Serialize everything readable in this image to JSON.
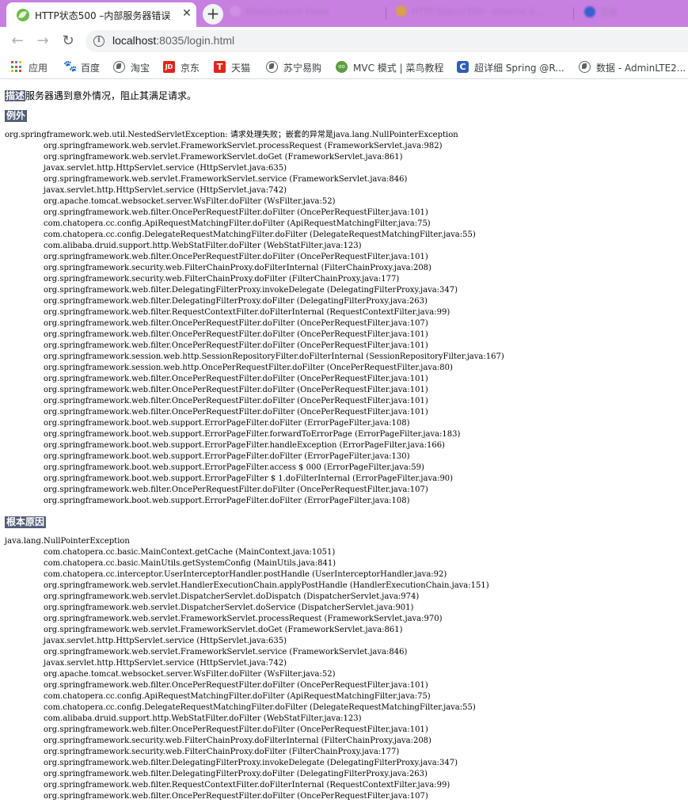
{
  "browser": {
    "active_tab": {
      "title": "HTTP状态500 –内部服务器错误"
    },
    "other_tabs": [
      "Elasticsearch Head",
      "HTTP Status 500 - Internal S...",
      "百度"
    ],
    "url": {
      "host": "localhost",
      "rest": ":8035/login.html"
    }
  },
  "bookmarks": [
    {
      "label": "应用",
      "icon": "apps-grid-icon"
    },
    {
      "label": "百度",
      "icon": "baidu-paw-icon"
    },
    {
      "label": "淘宝",
      "icon": "globe-icon"
    },
    {
      "label": "京东",
      "icon": "jd-icon"
    },
    {
      "label": "天猫",
      "icon": "tmall-icon"
    },
    {
      "label": "苏宁易购",
      "icon": "globe-icon"
    },
    {
      "label": "MVC 模式 | 菜鸟教程",
      "icon": "runoob-icon"
    },
    {
      "label": "超详细 Spring @R...",
      "icon": "c-icon"
    },
    {
      "label": "数据 - AdminLTE2...",
      "icon": "globe-icon"
    }
  ],
  "error_page": {
    "description_label": "描述",
    "description_text": "服务器遇到意外情况，阻止其满足请求。",
    "exception_label": "例外",
    "exception_head": "org.springframework.web.util.NestedServletException: 请求处理失败；嵌套的异常是java.lang.NullPointerException",
    "exception_frames": [
      "org.springframework.web.servlet.FrameworkServlet.processRequest (FrameworkServlet.java:982)",
      "org.springframework.web.servlet.FrameworkServlet.doGet (FrameworkServlet.java:861)",
      "javax.servlet.http.HttpServlet.service (HttpServlet.java:635)",
      "org.springframework.web.servlet.FrameworkServlet.service (FrameworkServlet.java:846)",
      "javax.servlet.http.HttpServlet.service (HttpServlet.java:742)",
      "org.apache.tomcat.websocket.server.WsFilter.doFilter (WsFilter.java:52)",
      "org.springframework.web.filter.OncePerRequestFilter.doFilter (OncePerRequestFilter.java:101)",
      "com.chatopera.cc.config.ApiRequestMatchingFilter.doFilter (ApiRequestMatchingFilter.java:75)",
      "com.chatopera.cc.config.DelegateRequestMatchingFilter.doFilter (DelegateRequestMatchingFilter.java:55)",
      "com.alibaba.druid.support.http.WebStatFilter.doFilter (WebStatFilter.java:123)",
      "org.springframework.web.filter.OncePerRequestFilter.doFilter (OncePerRequestFilter.java:101)",
      "org.springframework.security.web.FilterChainProxy.doFilterInternal (FilterChainProxy.java:208)",
      "org.springframework.security.web.FilterChainProxy.doFilter (FilterChainProxy.java:177)",
      "org.springframework.web.filter.DelegatingFilterProxy.invokeDelegate (DelegatingFilterProxy.java:347)",
      "org.springframework.web.filter.DelegatingFilterProxy.doFilter (DelegatingFilterProxy.java:263)",
      "org.springframework.web.filter.RequestContextFilter.doFilterInternal (RequestContextFilter.java:99)",
      "org.springframework.web.filter.OncePerRequestFilter.doFilter (OncePerRequestFilter.java:107)",
      "org.springframework.web.filter.OncePerRequestFilter.doFilter (OncePerRequestFilter.java:101)",
      "org.springframework.web.filter.OncePerRequestFilter.doFilter (OncePerRequestFilter.java:101)",
      "org.springframework.session.web.http.SessionRepositoryFilter.doFilterInternal (SessionRepositoryFilter.java:167)",
      "org.springframework.session.web.http.OncePerRequestFilter.doFilter (OncePerRequestFilter.java:80)",
      "org.springframework.web.filter.OncePerRequestFilter.doFilter (OncePerRequestFilter.java:101)",
      "org.springframework.web.filter.OncePerRequestFilter.doFilter (OncePerRequestFilter.java:101)",
      "org.springframework.web.filter.OncePerRequestFilter.doFilter (OncePerRequestFilter.java:101)",
      "org.springframework.web.filter.OncePerRequestFilter.doFilter (OncePerRequestFilter.java:101)",
      "org.springframework.boot.web.support.ErrorPageFilter.doFilter (ErrorPageFilter.java:108)",
      "org.springframework.boot.web.support.ErrorPageFilter.forwardToErrorPage (ErrorPageFilter.java:183)",
      "org.springframework.boot.web.support.ErrorPageFilter.handleException (ErrorPageFilter.java:166)",
      "org.springframework.boot.web.support.ErrorPageFilter.doFilter (ErrorPageFilter.java:130)",
      "org.springframework.boot.web.support.ErrorPageFilter.access $ 000 (ErrorPageFilter.java:59)",
      "org.springframework.boot.web.support.ErrorPageFilter $ 1.doFilterInternal (ErrorPageFilter.java:90)",
      "org.springframework.web.filter.OncePerRequestFilter.doFilter (OncePerRequestFilter.java:107)",
      "org.springframework.boot.web.support.ErrorPageFilter.doFilter (ErrorPageFilter.java:108)"
    ],
    "root_cause_label": "根本原因",
    "root_cause_head": "java.lang.NullPointerException",
    "root_cause_frames": [
      "com.chatopera.cc.basic.MainContext.getCache (MainContext.java:1051)",
      "com.chatopera.cc.basic.MainUtils.getSystemConfig (MainUtils.java:841)",
      "com.chatopera.cc.interceptor.UserInterceptorHandler.postHandle (UserInterceptorHandler.java:92)",
      "org.springframework.web.servlet.HandlerExecutionChain.applyPostHandle (HandlerExecutionChain.java:151)",
      "org.springframework.web.servlet.DispatcherServlet.doDispatch (DispatcherServlet.java:974)",
      "org.springframework.web.servlet.DispatcherServlet.doService (DispatcherServlet.java:901)",
      "org.springframework.web.servlet.FrameworkServlet.processRequest (FrameworkServlet.java:970)",
      "org.springframework.web.servlet.FrameworkServlet.doGet (FrameworkServlet.java:861)",
      "javax.servlet.http.HttpServlet.service (HttpServlet.java:635)",
      "org.springframework.web.servlet.FrameworkServlet.service (FrameworkServlet.java:846)",
      "javax.servlet.http.HttpServlet.service (HttpServlet.java:742)",
      "org.apache.tomcat.websocket.server.WsFilter.doFilter (WsFilter.java:52)",
      "org.springframework.web.filter.OncePerRequestFilter.doFilter (OncePerRequestFilter.java:101)",
      "com.chatopera.cc.config.ApiRequestMatchingFilter.doFilter (ApiRequestMatchingFilter.java:75)",
      "com.chatopera.cc.config.DelegateRequestMatchingFilter.doFilter (DelegateRequestMatchingFilter.java:55)",
      "com.alibaba.druid.support.http.WebStatFilter.doFilter (WebStatFilter.java:123)",
      "org.springframework.web.filter.OncePerRequestFilter.doFilter (OncePerRequestFilter.java:101)",
      "org.springframework.security.web.FilterChainProxy.doFilterInternal (FilterChainProxy.java:208)",
      "org.springframework.security.web.FilterChainProxy.doFilter (FilterChainProxy.java:177)",
      "org.springframework.web.filter.DelegatingFilterProxy.invokeDelegate (DelegatingFilterProxy.java:347)",
      "org.springframework.web.filter.DelegatingFilterProxy.doFilter (DelegatingFilterProxy.java:263)",
      "org.springframework.web.filter.RequestContextFilter.doFilterInternal (RequestContextFilter.java:99)",
      "org.springframework.web.filter.OncePerRequestFilter.doFilter (OncePerRequestFilter.java:107)"
    ]
  },
  "colors": {
    "tabstrip": "#c77fe0",
    "section_header_bg": "#525d76",
    "section_header_text": "#ffffff"
  }
}
